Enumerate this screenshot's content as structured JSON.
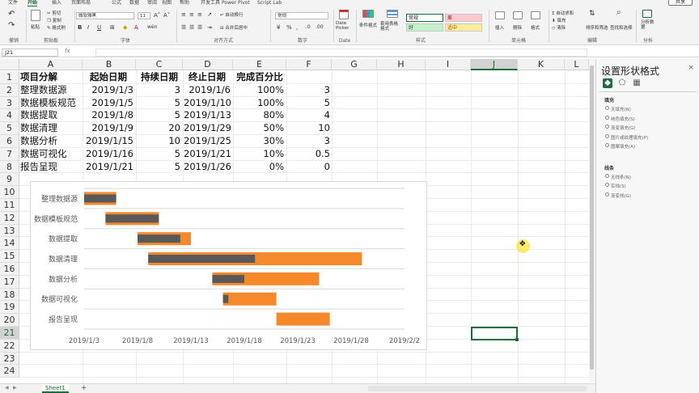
{
  "ribbon": {
    "tabs": [
      "文件",
      "开始",
      "插入",
      "页面布局",
      "公式",
      "数据",
      "审阅",
      "视图",
      "帮助",
      "开发工具",
      "Power Pivot",
      "Script Lab"
    ],
    "active_tab": "开始",
    "share_label": "共享",
    "groups": {
      "clipboard": {
        "label": "剪贴板",
        "paste": "粘贴",
        "cut": "剪切",
        "copy": "复制",
        "format_painter": "格式刷",
        "undo": "撤销"
      },
      "font": {
        "label": "字体",
        "font_name": "微软雅黑",
        "font_size": "11"
      },
      "alignment": {
        "label": "对齐方式",
        "wrap": "自动换行",
        "merge": "合并后居中"
      },
      "number": {
        "label": "数字",
        "format": "常规"
      },
      "date": {
        "label": "Date",
        "picker": "Date Picker"
      },
      "styles": {
        "label": "样式",
        "conditional": "条件格式",
        "table": "套用表格格式",
        "normal": "常规",
        "bad": "差",
        "good": "好",
        "neutral": "适中"
      },
      "cells": {
        "label": "单元格",
        "insert": "插入",
        "delete": "删除",
        "format": "格式"
      },
      "editing": {
        "label": "编辑",
        "autosum": "自动求和",
        "fill": "填充",
        "clear": "清除",
        "sort": "排序和筛选",
        "find": "查找和选择"
      },
      "analysis": {
        "label": "分析",
        "analyze": "分析数据"
      }
    }
  },
  "formula_bar": {
    "name_box": "J21",
    "fx": "fx",
    "value": ""
  },
  "grid": {
    "columns": [
      "A",
      "B",
      "C",
      "D",
      "E",
      "F",
      "G",
      "H",
      "I",
      "J",
      "K",
      "L"
    ],
    "selected_column": "J",
    "rows": [
      "1",
      "2",
      "3",
      "4",
      "5",
      "6",
      "7",
      "8",
      "9",
      "10",
      "11",
      "12",
      "13",
      "14",
      "15",
      "16",
      "17",
      "18",
      "19",
      "20",
      "21",
      "22",
      "23",
      "24"
    ],
    "selected_row": "21",
    "headers": [
      "项目分解",
      "起始日期",
      "持续日期",
      "终止日期",
      "完成百分比"
    ],
    "data": [
      {
        "task": "整理数据源",
        "start": "2019/1/3",
        "duration": "3",
        "end": "2019/1/6",
        "pct": "100%",
        "f": "3"
      },
      {
        "task": "数据模板规范",
        "start": "2019/1/5",
        "duration": "5",
        "end": "2019/1/10",
        "pct": "100%",
        "f": "5"
      },
      {
        "task": "数据提取",
        "start": "2019/1/8",
        "duration": "5",
        "end": "2019/1/13",
        "pct": "80%",
        "f": "4"
      },
      {
        "task": "数据清理",
        "start": "2019/1/9",
        "duration": "20",
        "end": "2019/1/29",
        "pct": "50%",
        "f": "10"
      },
      {
        "task": "数据分析",
        "start": "2019/1/15",
        "duration": "10",
        "end": "2019/1/25",
        "pct": "30%",
        "f": "3"
      },
      {
        "task": "数据可视化",
        "start": "2019/1/16",
        "duration": "5",
        "end": "2019/1/21",
        "pct": "10%",
        "f": "0.5"
      },
      {
        "task": "报告呈现",
        "start": "2019/1/21",
        "duration": "5",
        "end": "2019/1/26",
        "pct": "0%",
        "f": "0"
      }
    ]
  },
  "chart_data": {
    "type": "bar",
    "orientation": "horizontal-stacked-gantt",
    "categories": [
      "整理数据源",
      "数据模板规范",
      "数据提取",
      "数据清理",
      "数据分析",
      "数据可视化",
      "报告呈现"
    ],
    "x_tick_labels": [
      "2019/1/3",
      "2019/1/8",
      "2019/1/13",
      "2019/1/18",
      "2019/1/23",
      "2019/1/28",
      "2019/2/2"
    ],
    "xlim": [
      "2019/1/3",
      "2019/2/2"
    ],
    "start_dates": [
      "2019/1/3",
      "2019/1/5",
      "2019/1/8",
      "2019/1/9",
      "2019/1/15",
      "2019/1/16",
      "2019/1/21"
    ],
    "series": [
      {
        "values": [
          3,
          5,
          4,
          10,
          3,
          0.5,
          0
        ],
        "color": "#595959"
      },
      {
        "values": [
          3,
          5,
          5,
          20,
          10,
          5,
          5
        ],
        "color": "#f5892b"
      }
    ],
    "grid": true,
    "legend": "none"
  },
  "sheet_tabs": {
    "active": "Sheet1",
    "add": "+"
  },
  "format_pane": {
    "title": "设置形状格式",
    "close": "×",
    "sections": [
      {
        "title": "填充",
        "options": [
          "无填充(N)",
          "纯色填充(S)",
          "渐变填充(G)",
          "图片或纹理填充(P)",
          "图案填充(A)"
        ]
      },
      {
        "title": "线条",
        "options": [
          "无线条(N)",
          "实线(S)",
          "渐变线(G)"
        ]
      }
    ]
  }
}
